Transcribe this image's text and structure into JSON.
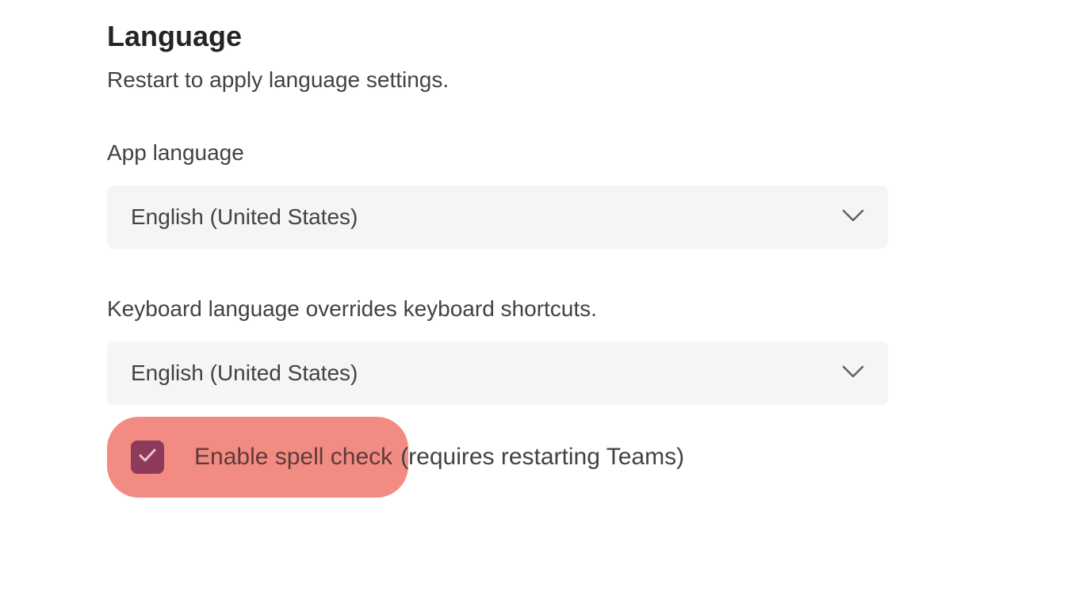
{
  "heading": "Language",
  "subtitle": "Restart to apply language settings.",
  "appLanguage": {
    "label": "App language",
    "value": "English (United States)"
  },
  "keyboardLanguage": {
    "label": "Keyboard language overrides keyboard shortcuts.",
    "value": "English (United States)"
  },
  "spellCheck": {
    "labelPart1": "Enable spell check",
    "labelPart2": " (requires restarting Teams)",
    "checked": true
  }
}
